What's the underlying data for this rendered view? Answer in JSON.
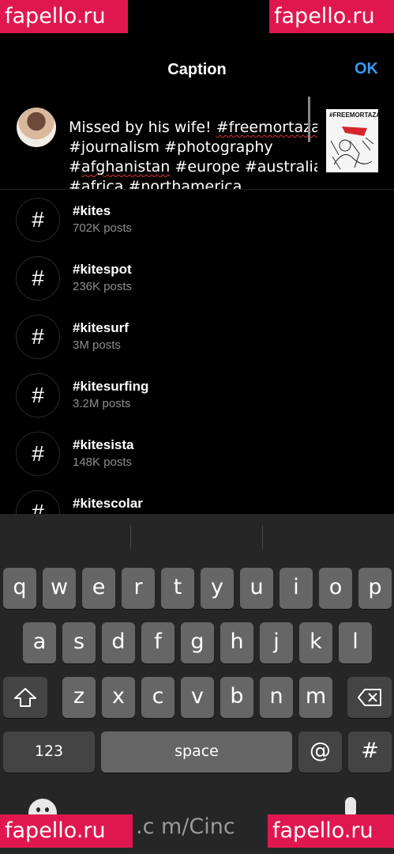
{
  "watermarks": {
    "top_left": "fapello.ru",
    "top_right": "fapello.ru",
    "bottom_left": "fapello.ru",
    "bottom_right": "fapello.ru"
  },
  "header": {
    "title": "Caption",
    "ok_label": "OK"
  },
  "composer": {
    "caption_lines": [
      [
        "Missed by his wife! ",
        "#freemortaza"
      ],
      [
        "#journalism #photography",
        ""
      ],
      [
        "#",
        "afghanistan",
        " #europe #australia"
      ],
      [
        "#africa #northamerica"
      ]
    ],
    "thumbnail_title": "#FREEMORTAZA"
  },
  "suggestions": [
    {
      "tag": "#kites",
      "count": "702K posts"
    },
    {
      "tag": "#kitespot",
      "count": "236K posts"
    },
    {
      "tag": "#kitesurf",
      "count": "3M posts"
    },
    {
      "tag": "#kitesurfing",
      "count": "3.2M posts"
    },
    {
      "tag": "#kitesista",
      "count": "148K posts"
    },
    {
      "tag": "#kitescolar",
      "count": ""
    }
  ],
  "keyboard": {
    "row1": [
      "q",
      "w",
      "e",
      "r",
      "t",
      "y",
      "u",
      "i",
      "o",
      "p"
    ],
    "row2": [
      "a",
      "s",
      "d",
      "f",
      "g",
      "h",
      "j",
      "k",
      "l"
    ],
    "row3": [
      "z",
      "x",
      "c",
      "v",
      "b",
      "n",
      "m"
    ],
    "numbers_label": "123",
    "space_label": "space",
    "at_label": "@",
    "hash_label": "#",
    "bottom_url": ".c m/Cinc"
  },
  "colors": {
    "accent": "#3897f0",
    "watermark": "#e0174f",
    "key": "#666666",
    "key_dark": "#444444"
  },
  "icons": {
    "shift": "shift-icon",
    "delete": "backspace-icon",
    "emoji": "emoji-icon",
    "mic": "microphone-icon"
  }
}
